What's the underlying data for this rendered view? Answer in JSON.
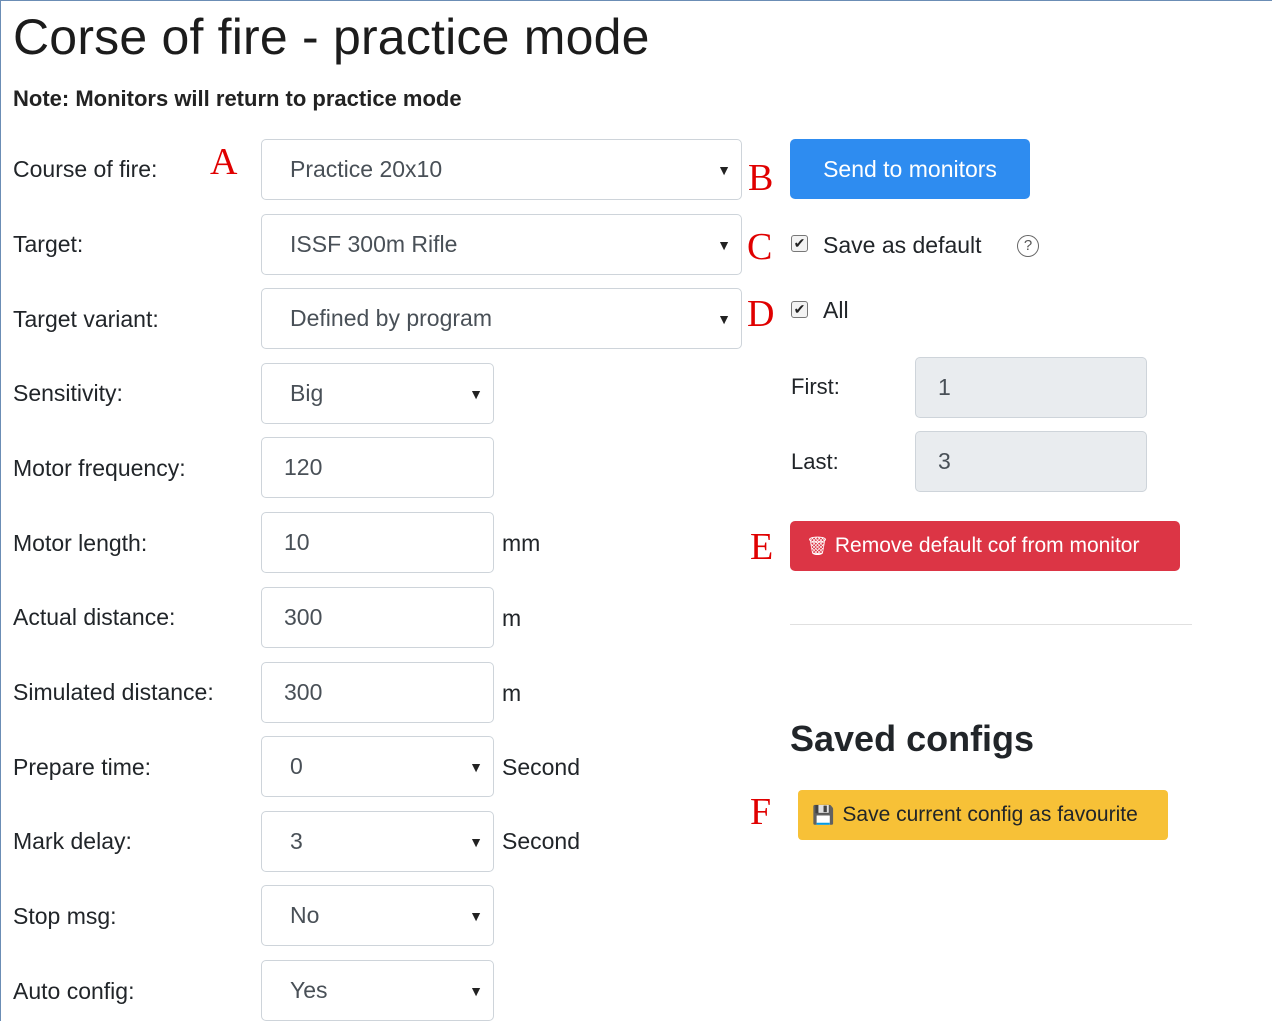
{
  "page": {
    "title": "Corse of fire - practice mode",
    "note": "Note: Monitors will return to practice mode"
  },
  "markers": {
    "a": "A",
    "b": "B",
    "c": "C",
    "d": "D",
    "e": "E",
    "f": "F"
  },
  "form": {
    "course_of_fire": {
      "label": "Course of fire:",
      "value": "Practice 20x10"
    },
    "target": {
      "label": "Target:",
      "value": "ISSF 300m Rifle"
    },
    "target_variant": {
      "label": "Target variant:",
      "value": "Defined by program"
    },
    "sensitivity": {
      "label": "Sensitivity:",
      "value": "Big"
    },
    "motor_frequency": {
      "label": "Motor frequency:",
      "value": "120"
    },
    "motor_length": {
      "label": "Motor length:",
      "value": "10",
      "unit": "mm"
    },
    "actual_distance": {
      "label": "Actual distance:",
      "value": "300",
      "unit": "m"
    },
    "simulated_distance": {
      "label": "Simulated distance:",
      "value": "300",
      "unit": "m"
    },
    "prepare_time": {
      "label": "Prepare time:",
      "value": "0",
      "unit": "Second"
    },
    "mark_delay": {
      "label": "Mark delay:",
      "value": "3",
      "unit": "Second"
    },
    "stop_msg": {
      "label": "Stop msg:",
      "value": "No"
    },
    "auto_config": {
      "label": "Auto config:",
      "value": "Yes"
    }
  },
  "actions": {
    "send_label": "Send to monitors",
    "save_default_label": "Save as default",
    "save_default_checked": true,
    "all_label": "All",
    "all_checked": true,
    "first_label": "First:",
    "first_value": "1",
    "last_label": "Last:",
    "last_value": "3",
    "remove_label": "Remove default cof from monitor",
    "remove_icon": "trash-icon",
    "help_icon": "question-circle-icon"
  },
  "saved": {
    "heading": "Saved configs",
    "save_fav_label": "Save current config as favourite",
    "save_icon": "floppy-disk-icon"
  },
  "colors": {
    "primary": "#2e8cf0",
    "danger": "#dc3545",
    "warning": "#f7c137",
    "marker": "#e00000"
  }
}
